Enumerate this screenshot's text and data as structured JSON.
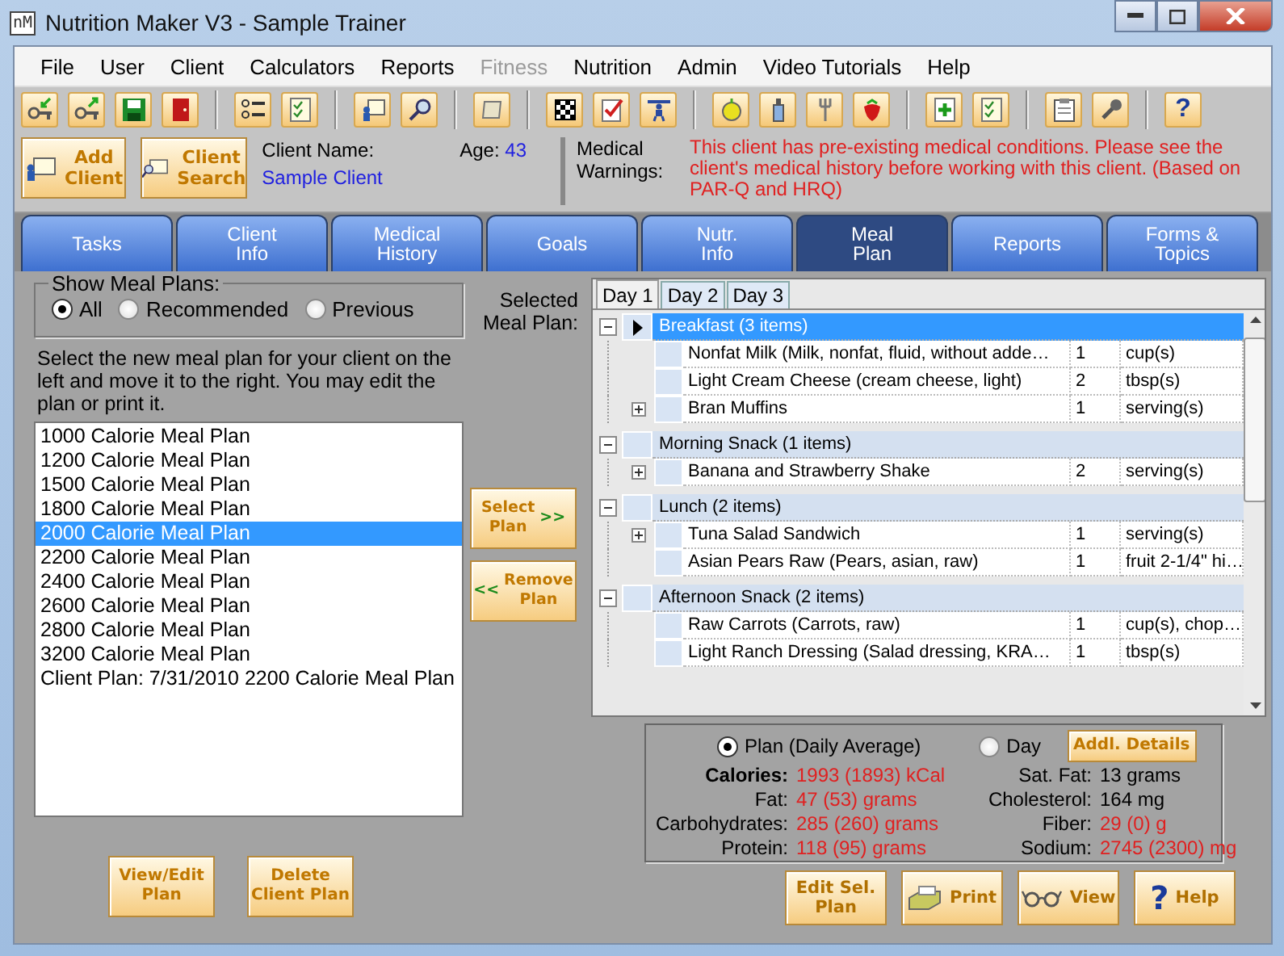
{
  "window": {
    "logo": "nM",
    "title": "Nutrition Maker V3 - Sample Trainer"
  },
  "menu": [
    {
      "label": "File",
      "disabled": false
    },
    {
      "label": "User",
      "disabled": false
    },
    {
      "label": "Client",
      "disabled": false
    },
    {
      "label": "Calculators",
      "disabled": false
    },
    {
      "label": "Reports",
      "disabled": false
    },
    {
      "label": "Fitness",
      "disabled": true
    },
    {
      "label": "Nutrition",
      "disabled": false
    },
    {
      "label": "Admin",
      "disabled": false
    },
    {
      "label": "Video Tutorials",
      "disabled": false
    },
    {
      "label": "Help",
      "disabled": false
    }
  ],
  "toolbar": {
    "help_glyph": "?"
  },
  "client_bar": {
    "buttons": [
      {
        "label": "Add\nClient",
        "kind": "add"
      },
      {
        "label": "Client\nSearch",
        "kind": "search"
      }
    ],
    "name_label": "Client Name:",
    "name": "Sample Client",
    "age_label": "Age:",
    "age": "43",
    "warnings_label": "Medical\nWarnings:",
    "warning": "This client has pre-existing medical conditions. Please see the client's medical history before working with this client.  (Based on PAR-Q and HRQ)"
  },
  "tabs": [
    {
      "label": "Tasks",
      "selected": false
    },
    {
      "label": "Client\nInfo",
      "selected": false
    },
    {
      "label": "Medical\nHistory",
      "selected": false
    },
    {
      "label": "Goals",
      "selected": false
    },
    {
      "label": "Nutr.\nInfo",
      "selected": false
    },
    {
      "label": "Meal\nPlan",
      "selected": true
    },
    {
      "label": "Reports",
      "selected": false
    },
    {
      "label": "Forms &\nTopics",
      "selected": false
    }
  ],
  "filter": {
    "title": "Show Meal Plans:",
    "options": [
      {
        "label": "All",
        "selected": true
      },
      {
        "label": "Recommended",
        "selected": false
      },
      {
        "label": "Previous",
        "selected": false
      }
    ]
  },
  "instructions": "Select the new meal plan for your client on the left and move it to the right.  You may edit the plan or print it.",
  "plans": [
    {
      "label": "1000 Calorie Meal Plan",
      "selected": false
    },
    {
      "label": "1200 Calorie Meal Plan",
      "selected": false
    },
    {
      "label": "1500 Calorie Meal Plan",
      "selected": false
    },
    {
      "label": "1800 Calorie Meal Plan",
      "selected": false
    },
    {
      "label": "2000 Calorie Meal Plan",
      "selected": true
    },
    {
      "label": "2200 Calorie Meal Plan",
      "selected": false
    },
    {
      "label": "2400 Calorie Meal Plan",
      "selected": false
    },
    {
      "label": "2600 Calorie Meal Plan",
      "selected": false
    },
    {
      "label": "2800 Calorie Meal Plan",
      "selected": false
    },
    {
      "label": "3200 Calorie Meal Plan",
      "selected": false
    },
    {
      "label": "Client Plan: 7/31/2010 2200 Calorie Meal Plan",
      "selected": false
    }
  ],
  "plan_buttons": [
    {
      "label": "View/Edit\nPlan"
    },
    {
      "label": "Delete\nClient Plan"
    }
  ],
  "transfer": {
    "label": "Selected\nMeal Plan:",
    "buttons": [
      {
        "label": "Select\nPlan",
        "arrow": ">>",
        "kind": "select"
      },
      {
        "label": "Remove\nPlan",
        "arrow": "<<",
        "kind": "remove"
      }
    ]
  },
  "days": [
    {
      "label": "Day 1",
      "selected": true
    },
    {
      "label": "Day 2",
      "selected": false
    },
    {
      "label": "Day 3",
      "selected": false
    }
  ],
  "meals": [
    {
      "title": "Breakfast (3 items)",
      "selected": true,
      "expanded": true,
      "foods": [
        {
          "name": "Nonfat Milk (Milk, nonfat, fluid, without adde…",
          "qty": "1",
          "unit": "cup(s)",
          "expandable": false
        },
        {
          "name": "Light Cream Cheese (cream cheese, light)",
          "qty": "2",
          "unit": "tbsp(s)",
          "expandable": false
        },
        {
          "name": "Bran Muffins",
          "qty": "1",
          "unit": "serving(s)",
          "expandable": true
        }
      ]
    },
    {
      "title": "Morning Snack (1 items)",
      "selected": false,
      "expanded": true,
      "foods": [
        {
          "name": "Banana and Strawberry Shake",
          "qty": "2",
          "unit": "serving(s)",
          "expandable": true
        }
      ]
    },
    {
      "title": "Lunch (2 items)",
      "selected": false,
      "expanded": true,
      "foods": [
        {
          "name": "Tuna Salad Sandwich",
          "qty": "1",
          "unit": "serving(s)",
          "expandable": true
        },
        {
          "name": "Asian Pears Raw (Pears, asian, raw)",
          "qty": "1",
          "unit": "fruit 2-1/4\" hi…",
          "expandable": false
        }
      ]
    },
    {
      "title": "Afternoon Snack (2 items)",
      "selected": false,
      "expanded": true,
      "foods": [
        {
          "name": "Raw Carrots (Carrots, raw)",
          "qty": "1",
          "unit": "cup(s), chop…",
          "expandable": false
        },
        {
          "name": "Light Ranch Dressing (Salad dressing, KRA…",
          "qty": "1",
          "unit": "tbsp(s)",
          "expandable": false
        }
      ]
    }
  ],
  "summary": {
    "modes": [
      {
        "label": "Plan (Daily Average)",
        "selected": true
      },
      {
        "label": "Day",
        "selected": false
      }
    ],
    "details_button": "Addl. Details",
    "rows": [
      {
        "label": "Calories:",
        "value": "1993 (1893) kCal",
        "flagged": true,
        "bold": true,
        "label_2": "Sat. Fat:",
        "value_2": "13 grams",
        "flagged_2": false
      },
      {
        "label": "Fat:",
        "value": "47 (53) grams",
        "flagged": true,
        "bold": false,
        "label_2": "Cholesterol:",
        "value_2": "164 mg",
        "flagged_2": false
      },
      {
        "label": "Carbohydrates:",
        "value": "285 (260) grams",
        "flagged": true,
        "bold": false,
        "label_2": "Fiber:",
        "value_2": "29 (0) g",
        "flagged_2": true
      },
      {
        "label": "Protein:",
        "value": "118 (95) grams",
        "flagged": true,
        "bold": false,
        "label_2": "Sodium:",
        "value_2": "2745 (2300) mg",
        "flagged_2": true
      }
    ]
  },
  "actions": [
    {
      "label": "Edit Sel.\nPlan",
      "kind": "edit"
    },
    {
      "label": "Print",
      "kind": "print"
    },
    {
      "label": "View",
      "kind": "view"
    },
    {
      "label": "Help",
      "kind": "help",
      "glyph": "?"
    }
  ]
}
